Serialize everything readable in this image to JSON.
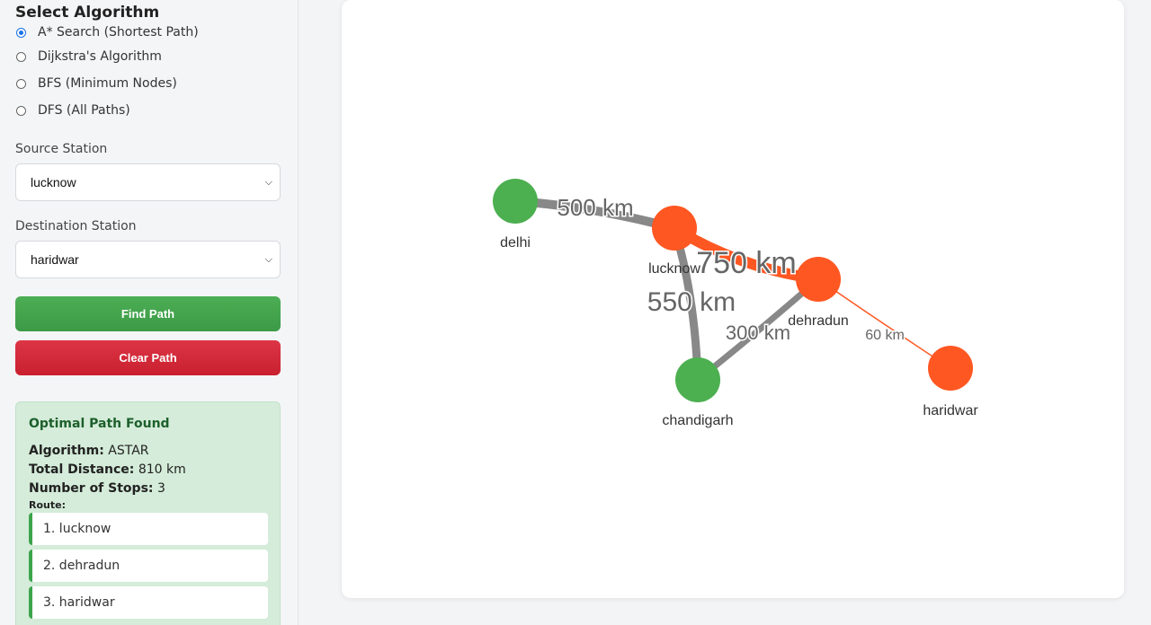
{
  "sidebar": {
    "algorithm_title": "Select Algorithm",
    "algorithms": [
      {
        "label": "A* Search (Shortest Path)",
        "checked": true
      },
      {
        "label": "Dijkstra's Algorithm",
        "checked": false
      },
      {
        "label": "BFS (Minimum Nodes)",
        "checked": false
      },
      {
        "label": "DFS (All Paths)",
        "checked": false
      }
    ],
    "source_label": "Source Station",
    "source_value": "lucknow",
    "destination_label": "Destination Station",
    "destination_value": "haridwar",
    "find_button": "Find Path",
    "clear_button": "Clear Path"
  },
  "result": {
    "title": "Optimal Path Found",
    "algorithm_key": "Algorithm:",
    "algorithm_value": "ASTAR",
    "distance_key": "Total Distance:",
    "distance_value": "810 km",
    "stops_key": "Number of Stops:",
    "stops_value": "3",
    "route_label": "Route:",
    "route": [
      "1. lucknow",
      "2. dehradun",
      "3. haridwar"
    ]
  },
  "graph": {
    "colors": {
      "path": "#ff5722",
      "default_node": "#4caf50",
      "edge": "#888888"
    },
    "nodes": [
      {
        "id": "delhi",
        "label": "delhi",
        "on_path": false
      },
      {
        "id": "lucknow",
        "label": "lucknow",
        "on_path": true
      },
      {
        "id": "dehradun",
        "label": "dehradun",
        "on_path": true
      },
      {
        "id": "chandigarh",
        "label": "chandigarh",
        "on_path": false
      },
      {
        "id": "haridwar",
        "label": "haridwar",
        "on_path": true
      }
    ],
    "edges": [
      {
        "from": "delhi",
        "to": "lucknow",
        "label": "500 km",
        "on_path": false
      },
      {
        "from": "lucknow",
        "to": "dehradun",
        "label": "750 km",
        "on_path": true
      },
      {
        "from": "lucknow",
        "to": "chandigarh",
        "label": "550 km",
        "on_path": false
      },
      {
        "from": "chandigarh",
        "to": "dehradun",
        "label": "300 km",
        "on_path": false
      },
      {
        "from": "dehradun",
        "to": "haridwar",
        "label": "60 km",
        "on_path": true
      }
    ]
  }
}
